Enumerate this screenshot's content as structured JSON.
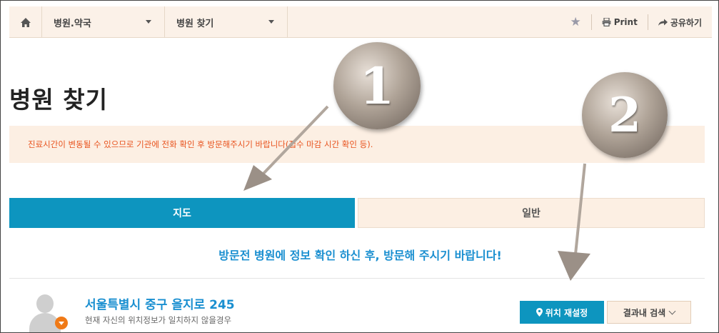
{
  "nav": {
    "home_icon": "home-icon",
    "dropdown1": "병원.약국",
    "dropdown2": "병원 찾기",
    "favorite_icon": "star-icon",
    "print_label": "Print",
    "share_label": "공유하기"
  },
  "page": {
    "title": "병원 찾기",
    "notice": "진료시간이 변동될 수 있으므로 기관에 전화 확인 후 방문해주시기 바랍니다(접수 마감 시간 확인 등)."
  },
  "tabs": {
    "map": "지도",
    "general": "일반"
  },
  "banner": "방문전 병원에 정보 확인 하신 후, 방문해 주시기 바랍니다!",
  "location": {
    "address": "서울특별시 중구 을지로 245",
    "subtext": "현재 자신의 위치정보가 일치하지 않을경우",
    "relocate_label": "위치 재설정",
    "search_label": "결과내 검색"
  },
  "annotations": {
    "marker1": "1",
    "marker2": "2"
  },
  "colors": {
    "accent": "#0d95bf",
    "link": "#1a8fd0",
    "notice_text": "#e8531e",
    "panel_bg": "#fcefe3"
  }
}
